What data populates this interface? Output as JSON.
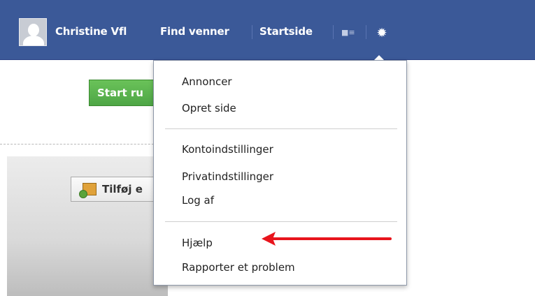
{
  "topbar": {
    "bg_color": "#3b5998",
    "user_name": "Christine Vfl",
    "find_friends": "Find venner",
    "home": "Startside",
    "icons": [
      "avatar",
      "friends-lists-icon",
      "gear-icon"
    ]
  },
  "left": {
    "start_button": "Start ru",
    "add_button": "Tilføj e",
    "start_button_color": "#4ea646"
  },
  "menu": {
    "groups": [
      [
        "Annoncer",
        "Opret side"
      ],
      [
        "Kontoindstillinger",
        "Privatindstillinger",
        "Log af"
      ],
      [
        "Hjælp",
        "Rapporter et problem"
      ]
    ]
  },
  "annotation": {
    "arrow_color": "#e8141c",
    "points_to": "Hjælp"
  }
}
